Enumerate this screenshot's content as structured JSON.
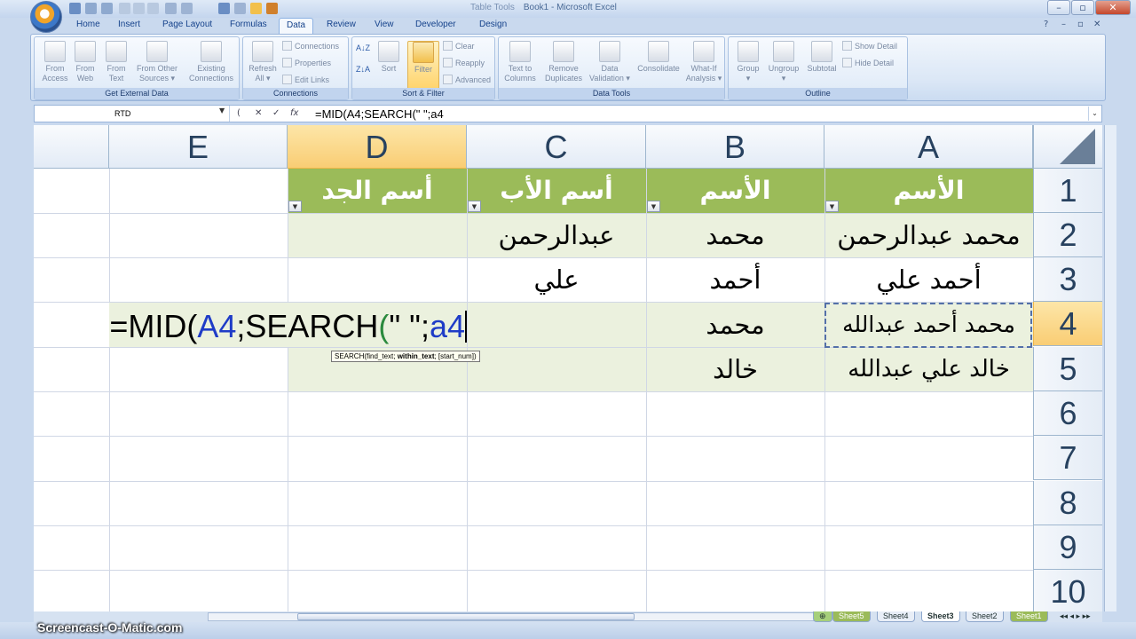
{
  "title_bar": {
    "contextual_label": "Table Tools",
    "title": "Book1 - Microsoft Excel"
  },
  "tabs": [
    "Home",
    "Insert",
    "Page Layout",
    "Formulas",
    "Data",
    "Review",
    "View",
    "Developer",
    "Design"
  ],
  "active_tab": "Data",
  "ribbon": {
    "get_external": {
      "label": "Get External Data",
      "buttons": [
        {
          "l1": "From",
          "l2": "Access"
        },
        {
          "l1": "From",
          "l2": "Web"
        },
        {
          "l1": "From",
          "l2": "Text"
        },
        {
          "l1": "From Other",
          "l2": "Sources ▾"
        },
        {
          "l1": "Existing",
          "l2": "Connections"
        }
      ]
    },
    "connections": {
      "label": "Connections",
      "refresh": {
        "l1": "Refresh",
        "l2": "All ▾"
      },
      "items": [
        "Connections",
        "Properties",
        "Edit Links"
      ]
    },
    "sort_filter": {
      "label": "Sort & Filter",
      "sort_az": "A↓Z",
      "sort_za": "Z↓A",
      "sort": "Sort",
      "filter": "Filter",
      "items": [
        "Clear",
        "Reapply",
        "Advanced"
      ]
    },
    "data_tools": {
      "label": "Data Tools",
      "buttons": [
        {
          "l1": "Text to",
          "l2": "Columns"
        },
        {
          "l1": "Remove",
          "l2": "Duplicates"
        },
        {
          "l1": "Data",
          "l2": "Validation ▾"
        },
        {
          "l1": "Consolidate",
          "l2": ""
        },
        {
          "l1": "What-If",
          "l2": "Analysis ▾"
        }
      ]
    },
    "outline": {
      "label": "Outline",
      "buttons": [
        {
          "l1": "Group",
          "l2": "▾"
        },
        {
          "l1": "Ungroup",
          "l2": "▾"
        },
        {
          "l1": "Subtotal",
          "l2": ""
        }
      ],
      "items": [
        "Show Detail",
        "Hide Detail"
      ]
    }
  },
  "formula_bar": {
    "name_box": "RTD",
    "formula": "=MID(A4;SEARCH(\" \";a4"
  },
  "grid": {
    "columns": [
      "E",
      "D",
      "C",
      "B",
      "A"
    ],
    "rows": [
      "1",
      "2",
      "3",
      "4",
      "5",
      "6",
      "7",
      "8",
      "9",
      "10"
    ],
    "headers": {
      "D": "أسم الجد",
      "C": "أسم الأب",
      "B": "الأسم",
      "A": "الأسم"
    },
    "cells": {
      "C2": "عبدالرحمن",
      "B2": "محمد",
      "A2": "محمد عبدالرحمن",
      "C3": "علي",
      "B3": "أحمد",
      "A3": "أحمد علي",
      "B4": "محمد",
      "A4": "محمد أحمد عبدالله",
      "B5": "خالد",
      "A5": "خالد علي عبدالله"
    },
    "edit": {
      "p1": "=MID(",
      "p2": "A4",
      "p3": ";SEARCH",
      "p4": "(",
      "p5": "\" \";",
      "p6": "a4"
    },
    "tooltip": {
      "func": "SEARCH(find_text; ",
      "bold": "within_text",
      "rest": "; [start_num])"
    }
  },
  "sheet_tabs": [
    "Sheet5",
    "Sheet4",
    "Sheet3",
    "Sheet2",
    "Sheet1"
  ],
  "active_sheet": "Sheet3",
  "watermark": "Screencast-O-Matic.com",
  "colors": {
    "header_fill": "#9bbb59",
    "band_fill": "#ebf1de",
    "selected_header": "#f9cd74"
  }
}
